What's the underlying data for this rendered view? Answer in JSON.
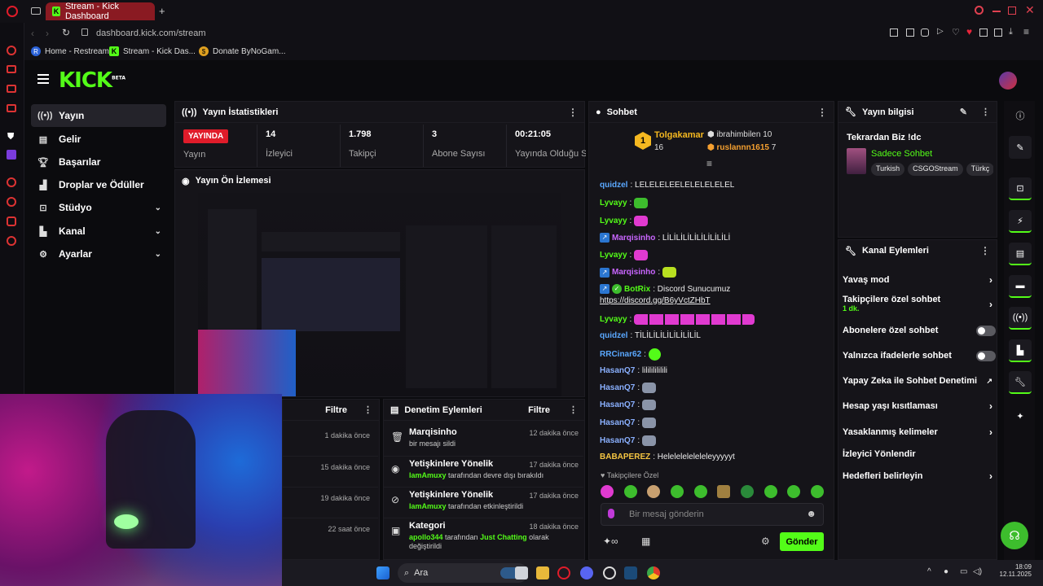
{
  "browser": {
    "tab_title": "Stream - Kick Dashboard",
    "url": "dashboard.kick.com/stream",
    "bookmarks": [
      {
        "label": "Home - Restream"
      },
      {
        "label": "Stream - Kick Das..."
      },
      {
        "label": "Donate ByNoGam..."
      }
    ]
  },
  "brand": {
    "logo": "KICK",
    "beta": "BETA",
    "accent": "#53fc18"
  },
  "sidebar": {
    "items": [
      {
        "label": "Yayın"
      },
      {
        "label": "Gelir"
      },
      {
        "label": "Başarılar"
      },
      {
        "label": "Droplar ve Ödüller"
      },
      {
        "label": "Stüdyo"
      },
      {
        "label": "Kanal"
      },
      {
        "label": "Ayarlar"
      }
    ]
  },
  "stats": {
    "title": "Yayın İstatistikleri",
    "live_badge": "YAYINDA",
    "live_label": "Yayın",
    "viewers": {
      "value": "14",
      "label": "İzleyici"
    },
    "followers": {
      "value": "1.798",
      "label": "Takipçi"
    },
    "subs": {
      "value": "3",
      "label": "Abone Sayısı"
    },
    "uptime": {
      "value": "00:21:05",
      "label": "Yayında Olduğu Süre"
    }
  },
  "preview": {
    "title": "Yayın Ön İzlemesi"
  },
  "left_log": {
    "filter_label": "Filtre",
    "rows": [
      {
        "time": "1 dakika önce"
      },
      {
        "time": "15 dakika önce"
      },
      {
        "time": "19 dakika önce"
      },
      {
        "time": "22 saat önce"
      }
    ]
  },
  "mod_actions": {
    "title": "Denetim Eylemleri",
    "filter_label": "Filtre",
    "rows": [
      {
        "title": "Marqisinho",
        "sub": "bir mesajı sildi",
        "time": "12 dakika önce"
      },
      {
        "title": "Yetişkinlere Yönelik",
        "user": "IamAmuxy",
        "sub": "tarafından devre dışı bırakıldı",
        "time": "17 dakika önce"
      },
      {
        "title": "Yetişkinlere Yönelik",
        "user": "IamAmuxy",
        "sub": "tarafından etkinleştirildi",
        "time": "17 dakika önce"
      },
      {
        "title": "Kategori",
        "user": "apollo344",
        "sub": "tarafından",
        "category": "Just Chatting",
        "sub2": "olarak değiştirildi",
        "time": "18 dakika önce"
      }
    ]
  },
  "chat": {
    "title": "Sohbet",
    "top_gifters": [
      {
        "rank": "1",
        "name": "Tolgakamar",
        "count": "16"
      },
      {
        "name": "ibrahimbilen",
        "count": "10"
      },
      {
        "name": "ruslannn1615",
        "count": "7"
      }
    ],
    "messages": [
      {
        "user": "quidzel",
        "text": ": LELELELEELELELELELEL",
        "color": "#5aa8ff"
      },
      {
        "user": "Lyvayy",
        "text": ":",
        "color": "#53fc18"
      },
      {
        "user": "Lyvayy",
        "text": ":",
        "color": "#53fc18"
      },
      {
        "user": "Marqisinho",
        "text": ": LİLİLİLİLİLİLİLİLİLİ",
        "color": "#c966ff"
      },
      {
        "user": "Lyvayy",
        "text": ":",
        "color": "#53fc18"
      },
      {
        "user": "Marqisinho",
        "text": ":",
        "color": "#c966ff"
      },
      {
        "user": "BotRix",
        "text": ": Discord Sunucumuz",
        "color": "#53fc18"
      },
      {
        "user": "",
        "text": "https://discord.gg/B6yVctZHbT",
        "color": "#fff"
      },
      {
        "user": "Lyvayy",
        "text": ":",
        "color": "#53fc18"
      },
      {
        "user": "quidzel",
        "text": ": TİLİLİLİLİLİLİLİLİL",
        "color": "#5aa8ff"
      },
      {
        "user": "RRCinar62",
        "text": ":",
        "color": "#5aa8ff"
      },
      {
        "user": "HasanQ7",
        "text": ": lilililililili",
        "color": "#8ab0ff"
      },
      {
        "user": "HasanQ7",
        "text": ":",
        "color": "#8ab0ff"
      },
      {
        "user": "HasanQ7",
        "text": ":",
        "color": "#8ab0ff"
      },
      {
        "user": "HasanQ7",
        "text": ":",
        "color": "#8ab0ff"
      },
      {
        "user": "HasanQ7",
        "text": ":",
        "color": "#8ab0ff"
      },
      {
        "user": "BABAPEREZ",
        "text": ": Heleleleleleleleyyyyyt",
        "color": "#f5c542"
      }
    ],
    "followers_only": "Takipçilere Özel",
    "input_placeholder": "Bir mesaj gönderin",
    "send_label": "Gönder"
  },
  "stream_info": {
    "title": "Yayın bilgisi",
    "stream_title": "Tekrardan Biz !dc",
    "category": "Sadece Sohbet",
    "tags": [
      "Turkish",
      "CSGOStream",
      "Türkç"
    ]
  },
  "channel_actions": {
    "title": "Kanal Eylemleri",
    "items": [
      {
        "label": "Yavaş mod"
      },
      {
        "label": "Takipçilere özel sohbet",
        "sub": "1 dk."
      },
      {
        "label": "Abonelere özel sohbet"
      },
      {
        "label": "Yalnızca ifadelerle sohbet"
      },
      {
        "label": "Yapay Zeka ile Sohbet Denetimi"
      },
      {
        "label": "Hesap yaşı kısıtlaması"
      },
      {
        "label": "Yasaklanmış kelimeler"
      },
      {
        "label": "İzleyici Yönlendir"
      },
      {
        "label": "Hedefleri belirleyin"
      }
    ]
  },
  "taskbar": {
    "search_label": "Ara",
    "time": "18:09",
    "date": "12.11.2025"
  }
}
